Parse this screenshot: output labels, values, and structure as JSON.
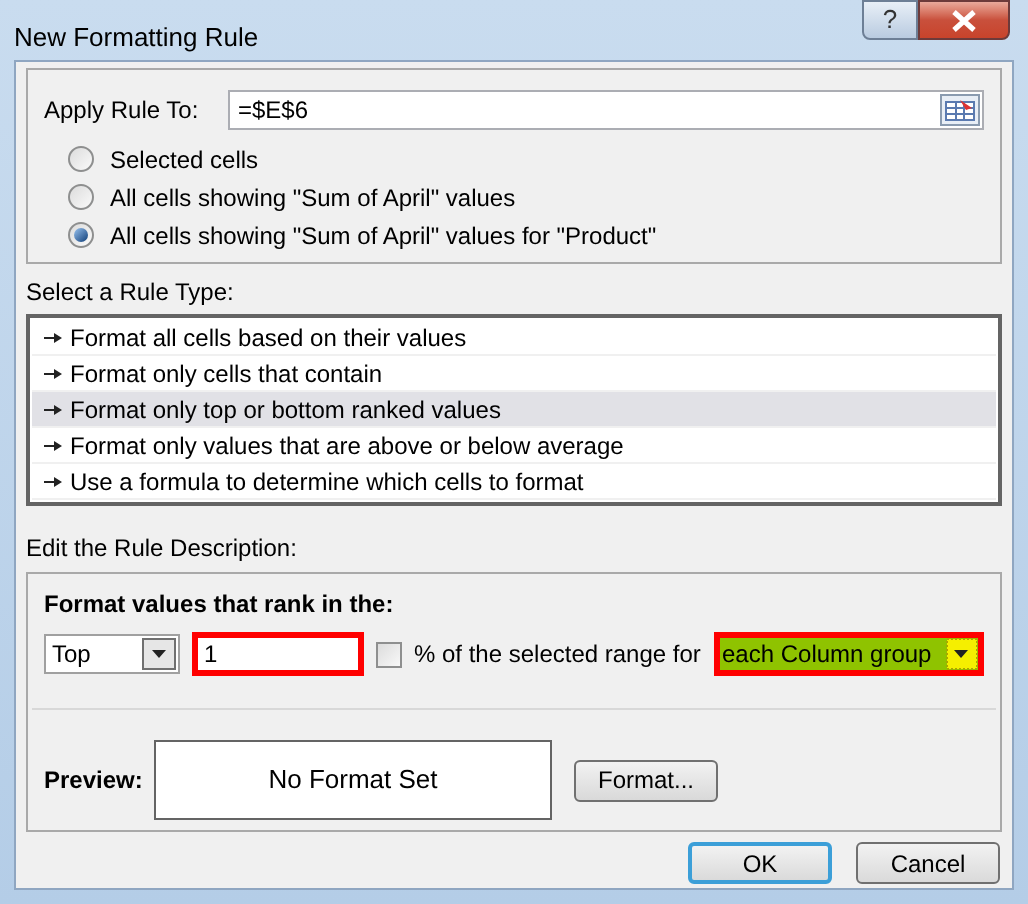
{
  "window": {
    "title": "New Formatting Rule",
    "help": "?"
  },
  "apply_rule_to": {
    "label": "Apply Rule To:",
    "value": "=$E$6"
  },
  "scope_options": [
    {
      "label": "Selected cells",
      "selected": false
    },
    {
      "label": "All cells showing \"Sum of April\" values",
      "selected": false
    },
    {
      "label": "All cells showing \"Sum of April\" values for \"Product\"",
      "selected": true
    }
  ],
  "rule_type": {
    "label": "Select a Rule Type:",
    "items": [
      {
        "label": "Format all cells based on their values",
        "selected": false
      },
      {
        "label": "Format only cells that contain",
        "selected": false
      },
      {
        "label": "Format only top or bottom ranked values",
        "selected": true
      },
      {
        "label": "Format only values that are above or below average",
        "selected": false
      },
      {
        "label": "Use a formula to determine which cells to format",
        "selected": false
      }
    ]
  },
  "description": {
    "label": "Edit the Rule Description:",
    "heading": "Format values that rank in the:",
    "direction": {
      "value": "Top"
    },
    "count": {
      "value": "1",
      "highlighted": true
    },
    "percent": {
      "label": "% of the selected range for",
      "checked": false
    },
    "group": {
      "value": "each Column group",
      "highlighted": true
    },
    "preview": {
      "label": "Preview:",
      "text": "No Format Set"
    },
    "format_button": "Format..."
  },
  "buttons": [
    {
      "label": "OK",
      "default": true
    },
    {
      "label": "Cancel",
      "default": false
    }
  ]
}
